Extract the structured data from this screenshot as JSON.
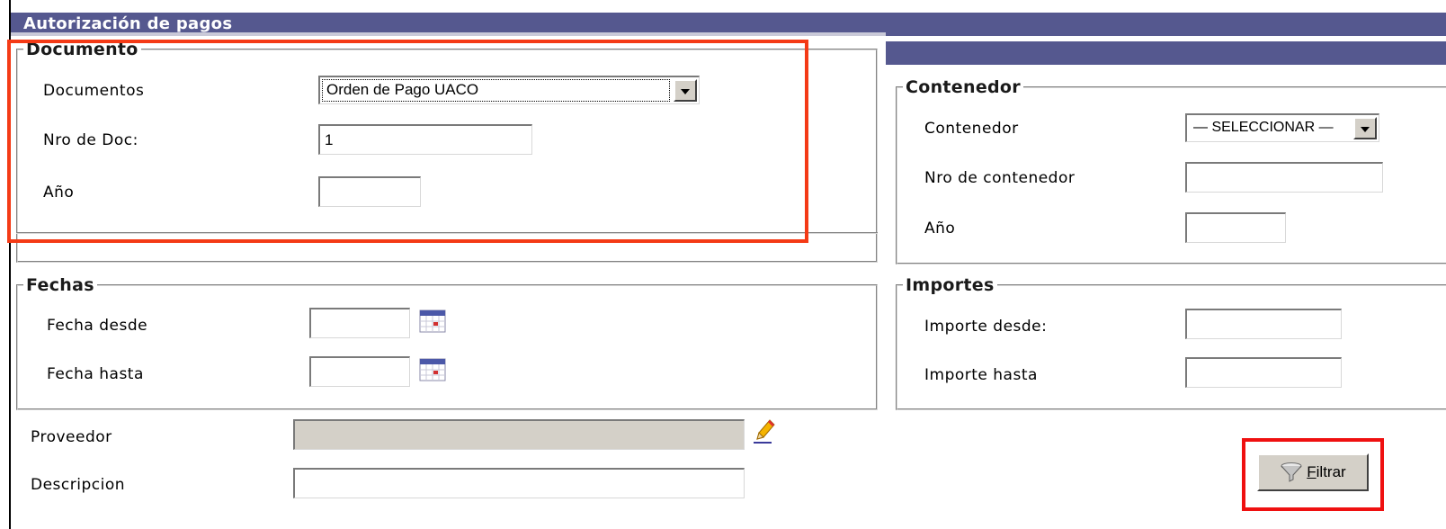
{
  "window": {
    "title": "Autorización de pagos"
  },
  "documento": {
    "legend": "Documento",
    "documentos_label": "Documentos",
    "documentos_value": "Orden de Pago UACO",
    "nro_label": "Nro de Doc:",
    "nro_value": "1",
    "anio_label": "Año",
    "anio_value": ""
  },
  "contenedor": {
    "legend": "Contenedor",
    "contenedor_label": "Contenedor",
    "contenedor_value": "— SELECCIONAR —",
    "nro_label": "Nro de contenedor",
    "nro_value": "",
    "anio_label": "Año",
    "anio_value": ""
  },
  "fechas": {
    "legend": "Fechas",
    "desde_label": "Fecha desde",
    "desde_value": "",
    "hasta_label": "Fecha hasta",
    "hasta_value": ""
  },
  "importes": {
    "legend": "Importes",
    "desde_label": "Importe desde:",
    "desde_value": "",
    "hasta_label": "Importe hasta",
    "hasta_value": ""
  },
  "proveedor": {
    "label": "Proveedor",
    "value": ""
  },
  "descripcion": {
    "label": "Descripcion",
    "value": ""
  },
  "filter_button": {
    "accel": "F",
    "rest": "iltrar"
  },
  "icons": {
    "calendar": "calendar-icon",
    "edit": "pencil-edit-icon",
    "filter": "funnel-filter-icon"
  },
  "colors": {
    "title_bar": "#55588f",
    "highlight_box": "#f43a16"
  }
}
